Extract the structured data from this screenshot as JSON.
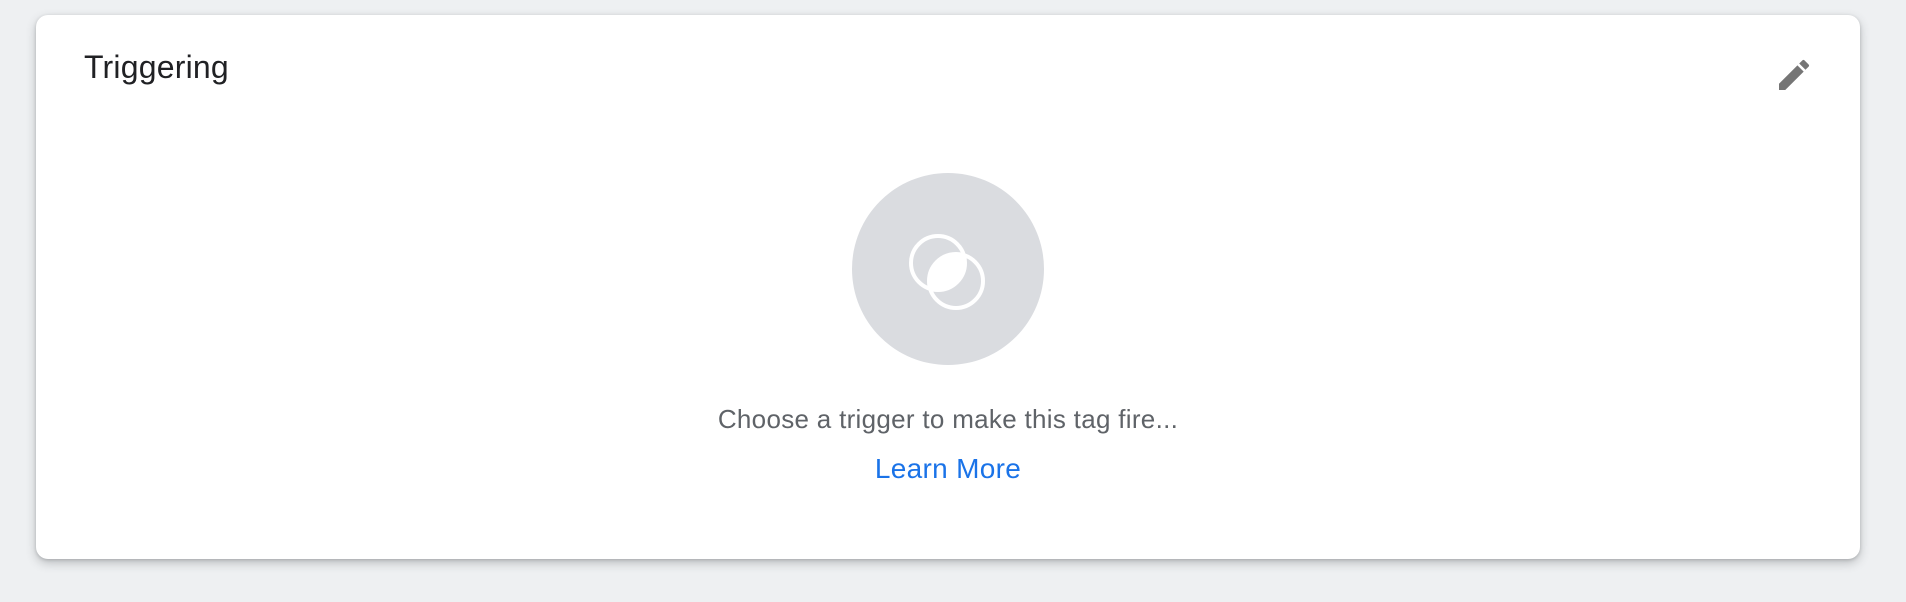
{
  "card": {
    "title": "Triggering",
    "edit_icon": "pencil-icon"
  },
  "empty_state": {
    "icon": "trigger-circles-icon",
    "message": "Choose a trigger to make this tag fire...",
    "link_label": "Learn More"
  },
  "colors": {
    "page_background": "#eef0f2",
    "card_background": "#ffffff",
    "icon_circle": "#dadce0",
    "link": "#1a73e8",
    "hint_text": "#5f6368",
    "edit_icon": "#757575"
  }
}
